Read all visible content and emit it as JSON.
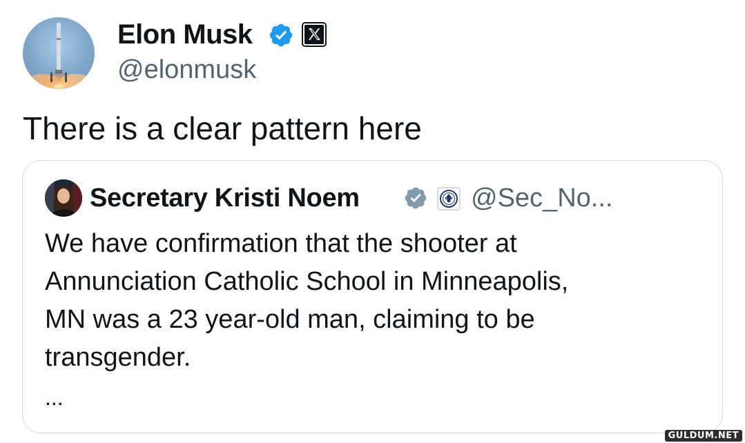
{
  "tweet": {
    "author": {
      "name": "Elon Musk",
      "handle": "@elonmusk",
      "verified_color": "#1d9bf0",
      "icons": [
        "rocket-launch-avatar",
        "verified-badge-icon",
        "x-logo-icon"
      ]
    },
    "text": "There is a clear pattern here"
  },
  "quoted_tweet": {
    "author": {
      "name": "Secretary Kristi Noem",
      "handle": "@Sec_No...",
      "verified_color": "#829aab",
      "icons": [
        "profile-photo-avatar",
        "verified-badge-icon",
        "dhs-seal-icon"
      ]
    },
    "text_lines": [
      "We have confirmation that the shooter at",
      "Annunciation Catholic School in Minneapolis,",
      "MN was a 23 year-old man, claiming to be",
      "transgender."
    ],
    "more": "..."
  },
  "watermark": "GULDUM.NET"
}
